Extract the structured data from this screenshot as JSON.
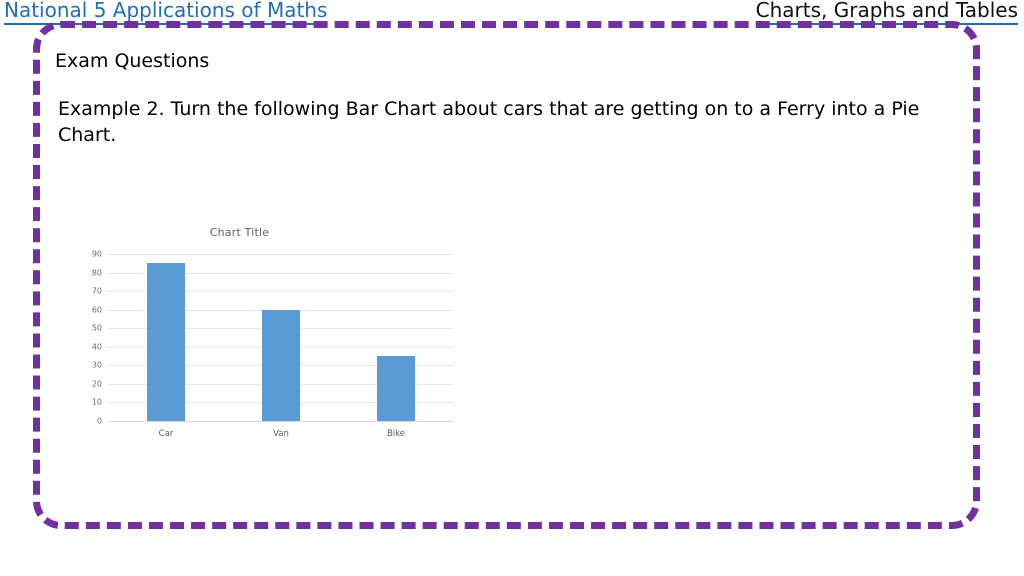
{
  "header": {
    "left_title": "National 5 Applications of Maths",
    "right_title": "Charts, Graphs and Tables",
    "left_color": "#1F6FB5",
    "right_color": "#101010",
    "underline_color": "#1F6FB5"
  },
  "frame": {
    "border_color": "#7030A0",
    "border_style": "dashed",
    "border_radius": "28px"
  },
  "slide": {
    "heading": "Exam Questions",
    "example": "Example 2. Turn the following Bar Chart about cars that are getting on to a Ferry into a Pie Chart."
  },
  "chart_data": {
    "type": "bar",
    "title": "Chart Title",
    "categories": [
      "Car",
      "Van",
      "Bike"
    ],
    "values": [
      85,
      60,
      35
    ],
    "xlabel": "",
    "ylabel": "",
    "ylim": [
      0,
      90
    ],
    "ytick_step": 10,
    "yticks": [
      90,
      80,
      70,
      60,
      50,
      40,
      30,
      20,
      10,
      0
    ],
    "grid": true,
    "legend": false,
    "series_color": "#5B9BD5",
    "gridline_color": "#E8E8E8",
    "title_color": "#606060",
    "tick_color": "#6A6A6A"
  }
}
